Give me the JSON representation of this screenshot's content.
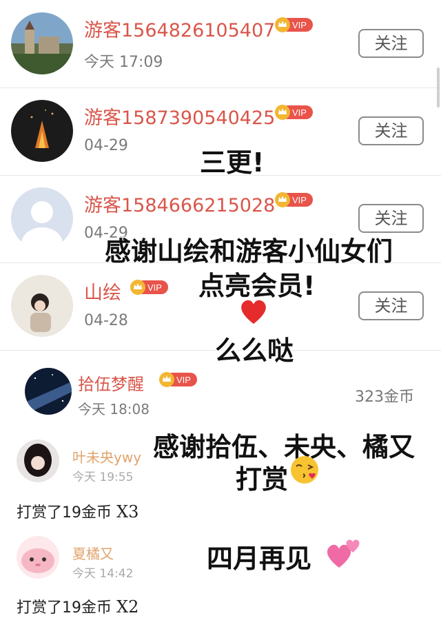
{
  "followers": [
    {
      "name": "游客1564826105407",
      "vip": "VIP",
      "time": "今天 17:09",
      "follow": "关注"
    },
    {
      "name": "游客1587390540425",
      "vip": "VIP",
      "time": "04-29",
      "follow": "关注"
    },
    {
      "name": "游客1584666215028",
      "vip": "VIP",
      "time": "04-29",
      "follow": "关注"
    },
    {
      "name": "山绘",
      "vip": "VIP",
      "time": "04-28",
      "follow": "关注"
    }
  ],
  "coin_row": {
    "name": "拾伍梦醒",
    "vip": "VIP",
    "time": "今天 18:08",
    "coins": "323金币"
  },
  "gifts": [
    {
      "name": "叶未央ywy",
      "time": "今天 19:55",
      "text": "打赏了19金币",
      "mult": "X3"
    },
    {
      "name": "夏橘又",
      "time": "今天 14:42",
      "text": "打赏了19金币",
      "mult": "X2"
    }
  ],
  "overlays": {
    "line1": "三更!",
    "line2": "感谢山绘和游客小仙女们",
    "line3": "点亮会员!",
    "line5": "么么哒",
    "line6": "感谢拾伍、未央、橘又",
    "line7": "打赏",
    "line8": "四月再见"
  },
  "colors": {
    "name": "#d9564a",
    "vip_badge": "#e8534a",
    "crown": "#f2b632",
    "gift_name": "#e0a36b"
  }
}
